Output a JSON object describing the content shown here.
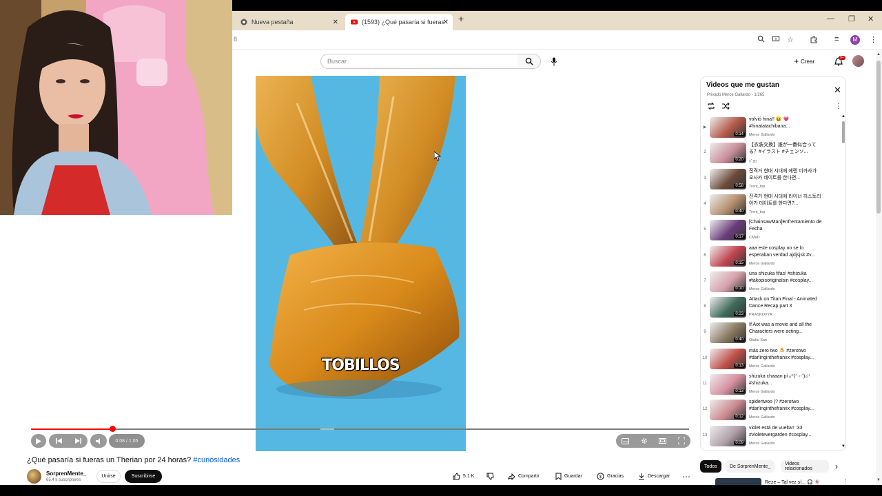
{
  "browser": {
    "tabs": [
      {
        "label": "Nueva pestaña",
        "active": false
      },
      {
        "label": "(1593) ¿Qué pasaría si fueras un",
        "active": true
      }
    ],
    "url_fragment": "8",
    "profile_letter": "M"
  },
  "youtube": {
    "search_placeholder": "Buscar",
    "create_label": "Crear",
    "notifications_badge": "9+"
  },
  "video": {
    "caption": "TOBILLOS",
    "time": "0:08 / 1:05",
    "progress_fraction": 0.124,
    "title": "¿Qué pasaría si fueras un Therian por 24 horas?",
    "hashtag": "#curiosidades"
  },
  "channel": {
    "name": "SorprenMente_",
    "subscribers": "65.4 k suscriptores",
    "join_label": "Unirse",
    "subscribe_label": "Suscribirse"
  },
  "actions": {
    "likes": "5.1 K",
    "share": "Compartir",
    "save": "Guardar",
    "thanks": "Gracias",
    "download": "Descargar"
  },
  "playlist": {
    "title": "Videos que me gustan",
    "subtitle": "Privado Merce Gallardo - 1/265",
    "items": [
      {
        "index": "▶",
        "title": "volvió hina!! 😆 💗 #hinatatachibana...",
        "channel": "Merce Gallardo",
        "duration": "0:14",
        "thumb": "#b35a4a"
      },
      {
        "index": "2",
        "title": "【衣装交換】誰が一番似合ってる？#イラスト #チェンソ...",
        "channel": "ﾊﾞﾛﾛ",
        "duration": "0:20",
        "thumb": "#c98f9a"
      },
      {
        "index": "3",
        "title": "진격거 현대 시대에 에렌 미카사가 오사카 데이트를 한다면...",
        "channel": "Trent_top",
        "duration": "0:58",
        "thumb": "#6b4a3a"
      },
      {
        "index": "4",
        "title": "진격거 현대 시대에 라이너 히스토리아가 데이트를 한다면?...",
        "channel": "Trent_top",
        "duration": "0:40",
        "thumb": "#b59070"
      },
      {
        "index": "5",
        "title": "[ChainsawMan]Enfrentamiento de Fecha",
        "channel": "CMaD",
        "duration": "0:17",
        "thumb": "#6a3c7a"
      },
      {
        "index": "6",
        "title": "aaa este cosplay no se lo esperaban verdad ajdjsjsk #v...",
        "channel": "Merce Gallardo",
        "duration": "0:15",
        "thumb": "#c04550"
      },
      {
        "index": "7",
        "title": "una shizuka fifas! #shizuka #takopisoriginalsin #cosplay...",
        "channel": "Merce Gallardo",
        "duration": "0:10",
        "thumb": "#d5a0a8"
      },
      {
        "index": "8",
        "title": "Attack on Titan Final - Animated Dance Recap part 3",
        "channel": "PRASKOVYA",
        "duration": "0:23",
        "thumb": "#3f6a5a"
      },
      {
        "index": "9",
        "title": "If Aot was a movie and all the Characters were acting...",
        "channel": "Otaku San",
        "duration": "0:40",
        "thumb": "#8a7a60"
      },
      {
        "index": "10",
        "title": "más zero two 🍮 #zerotwo #darlinginthefranxx #cosplay...",
        "channel": "Merce Gallardo",
        "duration": "0:13",
        "thumb": "#c0504a"
      },
      {
        "index": "11",
        "title": "shizuka chaaan pi ₍₍⁽⁽(ᵔ ᵕ ᵔ)₎₎⁾⁾ #shizuka...",
        "channel": "Merce Gallardo",
        "duration": "0:13",
        "thumb": "#d690a0"
      },
      {
        "index": "12",
        "title": "spidertwoo (? #zerotwo #darlinginthefranxx #cosplay...",
        "channel": "Merce Gallardo",
        "duration": "0:12",
        "thumb": "#c98a90"
      },
      {
        "index": "13",
        "title": "violet está de vuelta!! :33 #violetevergarden #cosplay...",
        "channel": "Merce Gallardo",
        "duration": "0:09",
        "thumb": "#b0a0a8"
      }
    ]
  },
  "chips": [
    "Todos",
    "De SorprenMente_",
    "Videos relacionados"
  ],
  "next_item": {
    "title": "Reze – Tal vez sí... 🎧 👻"
  }
}
